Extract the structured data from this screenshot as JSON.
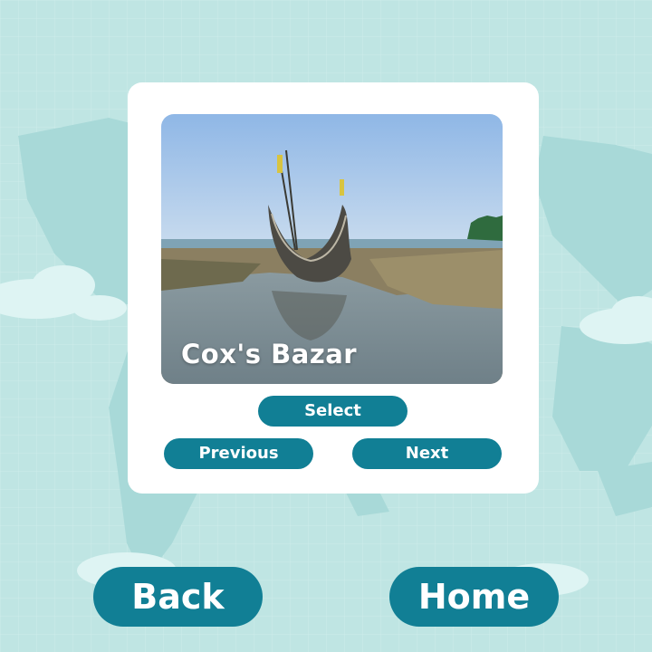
{
  "colors": {
    "background": "#bfe5e3",
    "accent": "#117f95",
    "card": "#ffffff"
  },
  "background_icon": "world-map-icon",
  "destination": {
    "caption": "Cox's Bazar",
    "image_icon": "boat-on-beach-photo"
  },
  "buttons": {
    "select": "Select",
    "previous": "Previous",
    "next": "Next",
    "back": "Back",
    "home": "Home"
  }
}
